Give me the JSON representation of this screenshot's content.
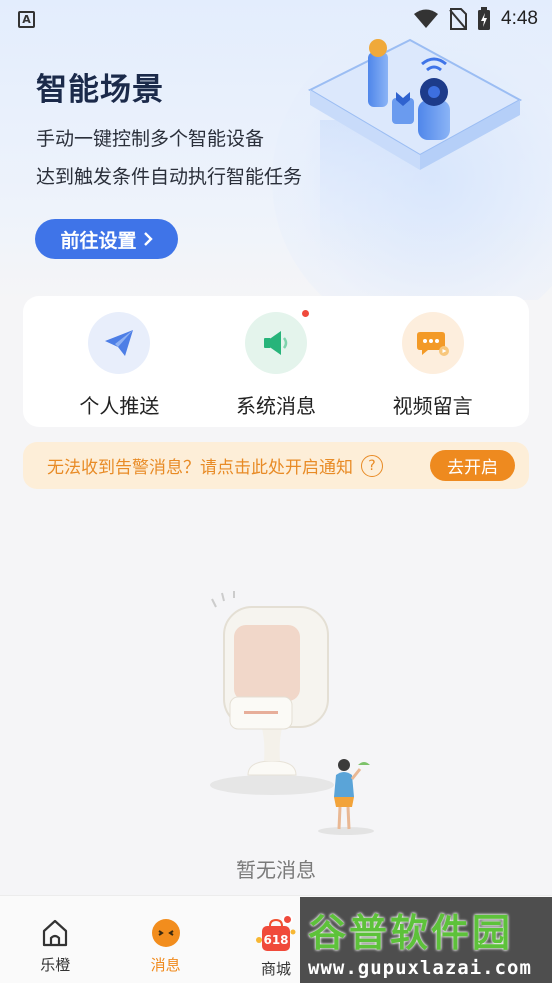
{
  "status_bar": {
    "time": "4:48",
    "app_icon_letter": "A"
  },
  "hero": {
    "title": "智能场景",
    "line1": "手动一键控制多个智能设备",
    "line2": "达到触发条件自动执行智能任务",
    "button_label": "前往设置"
  },
  "quick_actions": [
    {
      "label": "个人推送",
      "icon": "paper-plane-icon",
      "color": "#4d7ee6",
      "bg": "#e8eefb"
    },
    {
      "label": "系统消息",
      "icon": "speaker-icon",
      "color": "#27b47a",
      "bg": "#e4f4ec",
      "has_unread_dot": true
    },
    {
      "label": "视频留言",
      "icon": "chat-bubble-icon",
      "color": "#f39a27",
      "bg": "#fdeedd"
    }
  ],
  "notice": {
    "text": "无法收到告警消息？请点击此处开启通知",
    "help_symbol": "?",
    "button_label": "去开启"
  },
  "empty_state": {
    "text": "暂无消息"
  },
  "tabbar": {
    "tabs": [
      {
        "label": "乐橙",
        "icon": "home-icon",
        "active": false
      },
      {
        "label": "消息",
        "icon": "message-face-icon",
        "active": true,
        "has_unread_dot": true
      },
      {
        "label": "商城",
        "icon": "shopping-bag-icon",
        "active": false,
        "badge": "618"
      },
      {
        "label": "",
        "icon": "",
        "active": false
      },
      {
        "label": "",
        "icon": "",
        "active": false
      }
    ]
  },
  "watermark": {
    "title": "谷普软件园",
    "url": "www.gupuxlazai.com"
  },
  "colors": {
    "accent_blue": "#3f74e8",
    "accent_orange": "#ee8a1f",
    "notice_bg": "#fdeed8"
  }
}
